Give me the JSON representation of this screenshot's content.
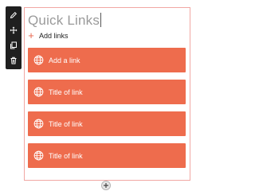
{
  "toolbar": {
    "items": [
      {
        "icon": "pencil-icon"
      },
      {
        "icon": "move-icon"
      },
      {
        "icon": "copy-icon"
      },
      {
        "icon": "trash-icon"
      }
    ]
  },
  "widget": {
    "title": "Quick Links",
    "add_label": "Add links",
    "add_icon": "+",
    "links": [
      {
        "label": "Add a link",
        "icon": "globe-icon"
      },
      {
        "label": "Title of link",
        "icon": "globe-icon"
      },
      {
        "label": "Title of link",
        "icon": "globe-icon"
      },
      {
        "label": "Title of link",
        "icon": "globe-icon"
      }
    ],
    "bottom_add_icon": "plus-circle-icon"
  },
  "colors": {
    "accent": "#ee6c4d",
    "frame": "#f1a7a3",
    "toolbar": "#1f1f1f"
  }
}
